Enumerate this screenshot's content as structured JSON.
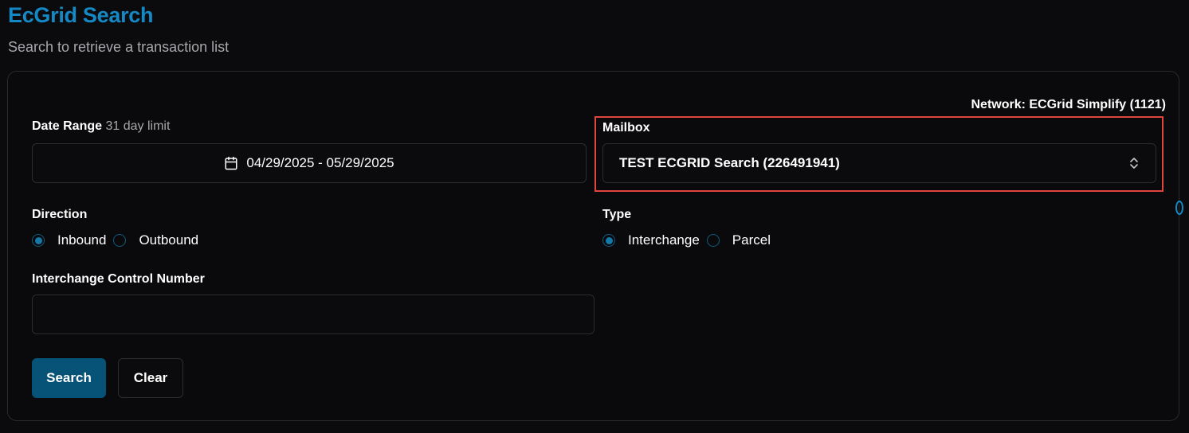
{
  "header": {
    "title": "EcGrid Search",
    "subtitle": "Search to retrieve a transaction list"
  },
  "network": "Network: ECGrid Simplify (1121)",
  "date_range": {
    "label": "Date Range",
    "hint": "31 day limit",
    "value": "04/29/2025 - 05/29/2025",
    "icon": "calendar-icon"
  },
  "mailbox": {
    "label": "Mailbox",
    "selected": "TEST ECGRID Search (226491941)",
    "icon": "chevron-up-down-icon"
  },
  "direction": {
    "label": "Direction",
    "options": [
      "Inbound",
      "Outbound"
    ],
    "selected": "Inbound"
  },
  "type": {
    "label": "Type",
    "options": [
      "Interchange",
      "Parcel"
    ],
    "selected": "Interchange"
  },
  "icn": {
    "label": "Interchange Control Number",
    "value": "",
    "placeholder": ""
  },
  "buttons": {
    "search": "Search",
    "clear": "Clear"
  },
  "colors": {
    "accent": "#1589c6",
    "primary_button": "#075277",
    "highlight": "#e0463e",
    "background": "#0b0b0d"
  }
}
